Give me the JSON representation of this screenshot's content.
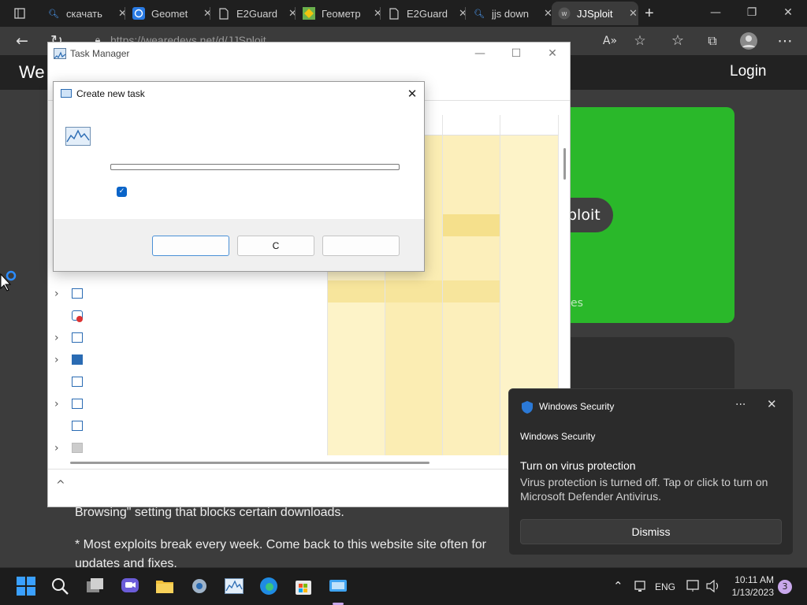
{
  "browser": {
    "tabs": [
      {
        "label": "",
        "icon": "tab-actions-icon"
      },
      {
        "label": "скачать",
        "icon": "search-icon"
      },
      {
        "label": "Geomet",
        "icon": "app-store-icon"
      },
      {
        "label": "E2Guard",
        "icon": "page-icon"
      },
      {
        "label": "Геометр",
        "icon": "game-icon"
      },
      {
        "label": "E2Guard",
        "icon": "page-icon"
      },
      {
        "label": "jjs down",
        "icon": "search-icon"
      },
      {
        "label": "JJSploit",
        "icon": "site-icon"
      }
    ],
    "new_tab": "+",
    "url": "https://wearedevs.net/d/JJSploit"
  },
  "site": {
    "logo_text": "We",
    "login": "Login",
    "download_label": "ploit",
    "green_note": "es",
    "text1": "Browsing\" setting that blocks certain downloads.",
    "text2": "* Most exploits break every week. Come back to this website site often for updates and fixes."
  },
  "task_manager": {
    "title": "Task Manager"
  },
  "dialog": {
    "title": "Create new task",
    "buttons": [
      {
        "label": ""
      },
      {
        "label": "C"
      },
      {
        "label": ""
      }
    ]
  },
  "toast": {
    "app": "Windows Security",
    "subtitle": "Windows Security",
    "heading": "Turn on virus protection",
    "body": "Virus protection is turned off. Tap or click to turn on Microsoft Defender Antivirus.",
    "dismiss": "Dismiss",
    "more": "···",
    "close": "✕"
  },
  "taskbar": {
    "lang": "ENG",
    "time": "10:11 AM",
    "date": "1/13/2023",
    "notif_count": "3"
  },
  "colors": {
    "accent_blue": "#0a64c8",
    "site_green": "#2ab82a",
    "cpu_yellow": "#fbefb8"
  }
}
